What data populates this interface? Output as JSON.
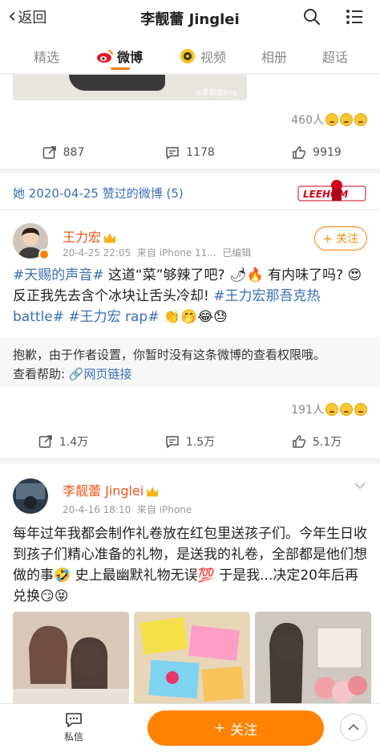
{
  "nav": {
    "back_label": "返回",
    "title": "李靓蕾 Jinglei"
  },
  "tabs": [
    {
      "label": "精选"
    },
    {
      "label": "微博"
    },
    {
      "label": "视频"
    },
    {
      "label": "相册"
    },
    {
      "label": "超话"
    }
  ],
  "post1": {
    "watermark": "@李靓蕾Jing...",
    "likers": "460人",
    "repost": "887",
    "comment": "1178",
    "like": "9919"
  },
  "liked_header": {
    "text": "她 2020-04-25 赞过的微博 (5)",
    "sticker_text": "LEEHOM"
  },
  "post2": {
    "author": "王力宏",
    "time": "20-4-25 22:05",
    "source": "来自 iPhone 11...",
    "edited": "已编辑",
    "follow": "+ 关注",
    "tag1": "#天赐的声音#",
    "text1": " 这道“菜”够辣了吧? 🌶🔥 有内味了吗? 😍 反正我先去含个冰块让舌头冷却! ",
    "tag2": "#王力宏那吾克热battle#",
    "tag3": " #王力宏 rap#",
    "emoji_tail": " 👏🤭😂😓",
    "notice": "抱歉，由于作者设置，你暂时没有这条微博的查看权限哦。",
    "help_label": "查看帮助: ",
    "help_link": "网页链接",
    "likers": "191人",
    "repost": "1.4万",
    "comment": "1.5万",
    "like": "5.1万"
  },
  "post3": {
    "author": "李靓蕾 Jinglei",
    "time": "20-4-16 18:10",
    "source": "来自 iPhone",
    "text": "每年过年我都会制作礼卷放在红包里送孩子们。今年生日收到孩子们精心准备的礼物，是送我的礼卷，全部都是他们想做的事🤣 史上最幽默礼物无误💯 于是我...决定20年后再兑换😏😝"
  },
  "bottom": {
    "dm_label": "私信",
    "follow_label": "关注",
    "follow_plus": "+"
  },
  "colors": {
    "accent": "#ff8200",
    "link": "#3a6fb5",
    "username": "#e8581a"
  }
}
